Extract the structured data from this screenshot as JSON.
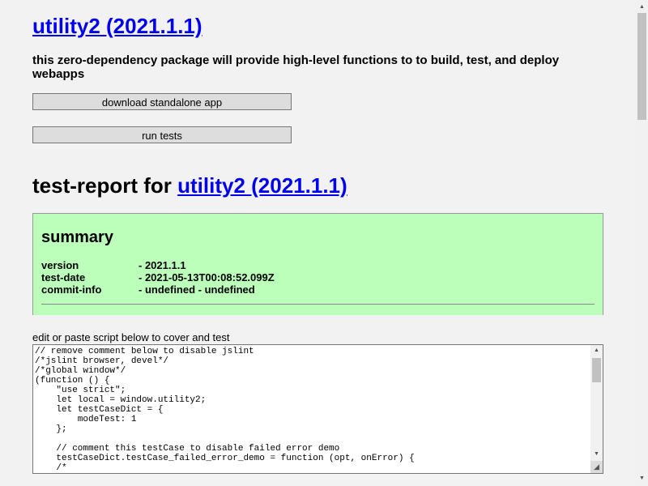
{
  "header": {
    "title_link": "utility2 (2021.1.1)",
    "description": "this zero-dependency package will provide high-level functions to to build, test, and deploy webapps"
  },
  "buttons": {
    "download_label": "download standalone app",
    "run_tests_label": "run tests"
  },
  "report": {
    "heading_prefix": "test-report for ",
    "heading_link": "utility2 (2021.1.1)"
  },
  "summary": {
    "heading": "summary",
    "rows": [
      {
        "key": "version",
        "value": "- 2021.1.1"
      },
      {
        "key": "test-date",
        "value": "- 2021-05-13T00:08:52.099Z"
      },
      {
        "key": "commit-info",
        "value": "- undefined - undefined"
      }
    ]
  },
  "editor": {
    "label": "edit or paste script below to cover and test",
    "code": "// remove comment below to disable jslint\n/*jslint browser, devel*/\n/*global window*/\n(function () {\n    \"use strict\";\n    let local = window.utility2;\n    let testCaseDict = {\n        modeTest: 1\n    };\n\n    // comment this testCase to disable failed error demo\n    testCaseDict.testCase_failed_error_demo = function (opt, onError) {\n    /*"
  },
  "icons": {
    "scroll_up": "arrow-up-icon",
    "scroll_down": "arrow-down-icon",
    "resize": "resize-grip-icon"
  },
  "colors": {
    "link": "#0000ee",
    "summary_bg": "#bbffbb",
    "page_bg": "#f2f2f2"
  }
}
